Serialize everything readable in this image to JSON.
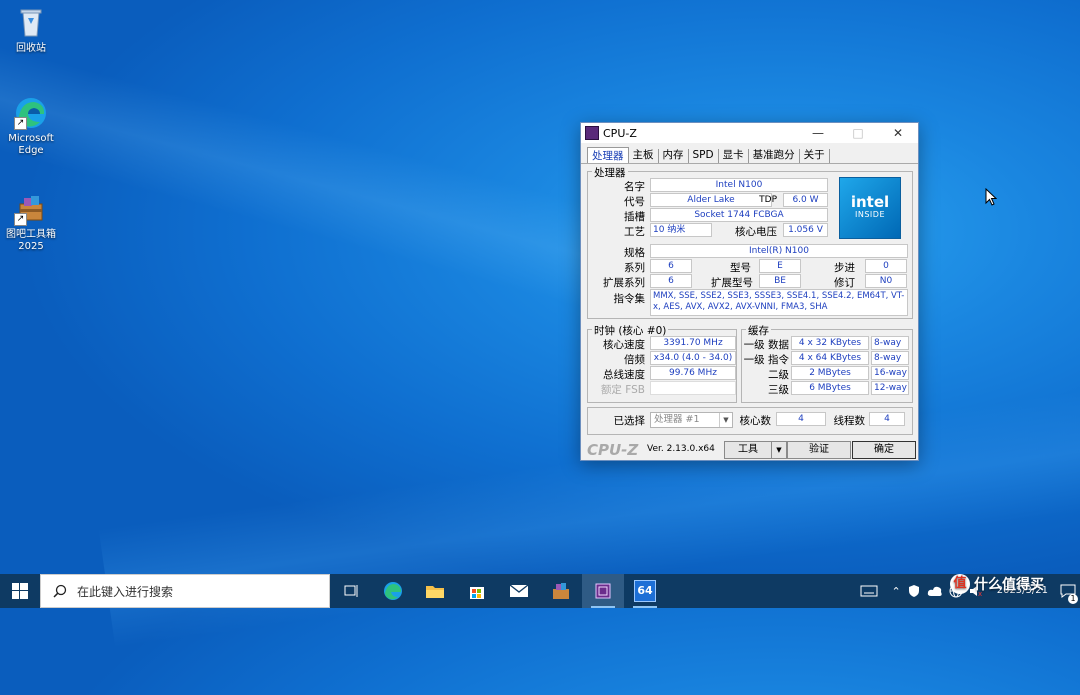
{
  "desktop": {
    "icons": [
      {
        "label": "回收站"
      },
      {
        "label": "Microsoft Edge"
      },
      {
        "label": "图吧工具箱 2025"
      }
    ]
  },
  "window": {
    "title": "CPU-Z",
    "tabs": [
      "处理器",
      "主板",
      "内存",
      "SPD",
      "显卡",
      "基准跑分",
      "关于"
    ],
    "processor": {
      "group_label": "处理器",
      "name_label": "名字",
      "name": "Intel N100",
      "codename_label": "代号",
      "codename": "Alder Lake",
      "tdp_label": "TDP",
      "tdp": "6.0 W",
      "package_label": "插槽",
      "package": "Socket 1744 FCBGA",
      "technology_label": "工艺",
      "technology": "10 纳米",
      "voltage_label": "核心电压",
      "voltage": "1.056 V",
      "spec_label": "规格",
      "spec": "Intel(R) N100",
      "family_label": "系列",
      "family": "6",
      "model_label": "型号",
      "model": "E",
      "stepping_label": "步进",
      "stepping": "0",
      "ext_family_label": "扩展系列",
      "ext_family": "6",
      "ext_model_label": "扩展型号",
      "ext_model": "BE",
      "revision_label": "修订",
      "revision": "N0",
      "instructions_label": "指令集",
      "instructions": "MMX, SSE, SSE2, SSE3, SSSE3, SSE4.1, SSE4.2, EM64T, VT-x, AES, AVX, AVX2, AVX-VNNI, FMA3, SHA",
      "logo_line1": "intel",
      "logo_line2": "INSIDE"
    },
    "clocks": {
      "group_label": "时钟 (核心 #0)",
      "core_speed_label": "核心速度",
      "core_speed": "3391.70 MHz",
      "multiplier_label": "倍频",
      "multiplier": "x34.0 (4.0 - 34.0)",
      "bus_speed_label": "总线速度",
      "bus_speed": "99.76 MHz",
      "rated_fsb_label": "额定 FSB",
      "rated_fsb": ""
    },
    "cache": {
      "group_label": "缓存",
      "l1d_label": "一级 数据",
      "l1d": "4 x 32 KBytes",
      "l1d_way": "8-way",
      "l1i_label": "一级 指令",
      "l1i": "4 x 64 KBytes",
      "l1i_way": "8-way",
      "l2_label": "二级",
      "l2": "2 MBytes",
      "l2_way": "16-way",
      "l3_label": "三级",
      "l3": "6 MBytes",
      "l3_way": "12-way"
    },
    "selection": {
      "selected_label": "已选择",
      "selected": "处理器 #1",
      "cores_label": "核心数",
      "cores": "4",
      "threads_label": "线程数",
      "threads": "4"
    },
    "footer": {
      "brand": "CPU-Z",
      "version": "Ver. 2.13.0.x64",
      "tools_label": "工具",
      "validate_label": "验证",
      "ok_label": "确定"
    }
  },
  "taskbar": {
    "search_placeholder": "在此键入进行搜索",
    "clock_time": "",
    "clock_date": "2025/3/21",
    "notification_count": "1",
    "app_64_label": "64",
    "watermark": "什么值得买"
  },
  "colors": {
    "accent": "#1e3fbf",
    "taskbar": "#0e3a63",
    "desktop": "#1a86e0"
  }
}
